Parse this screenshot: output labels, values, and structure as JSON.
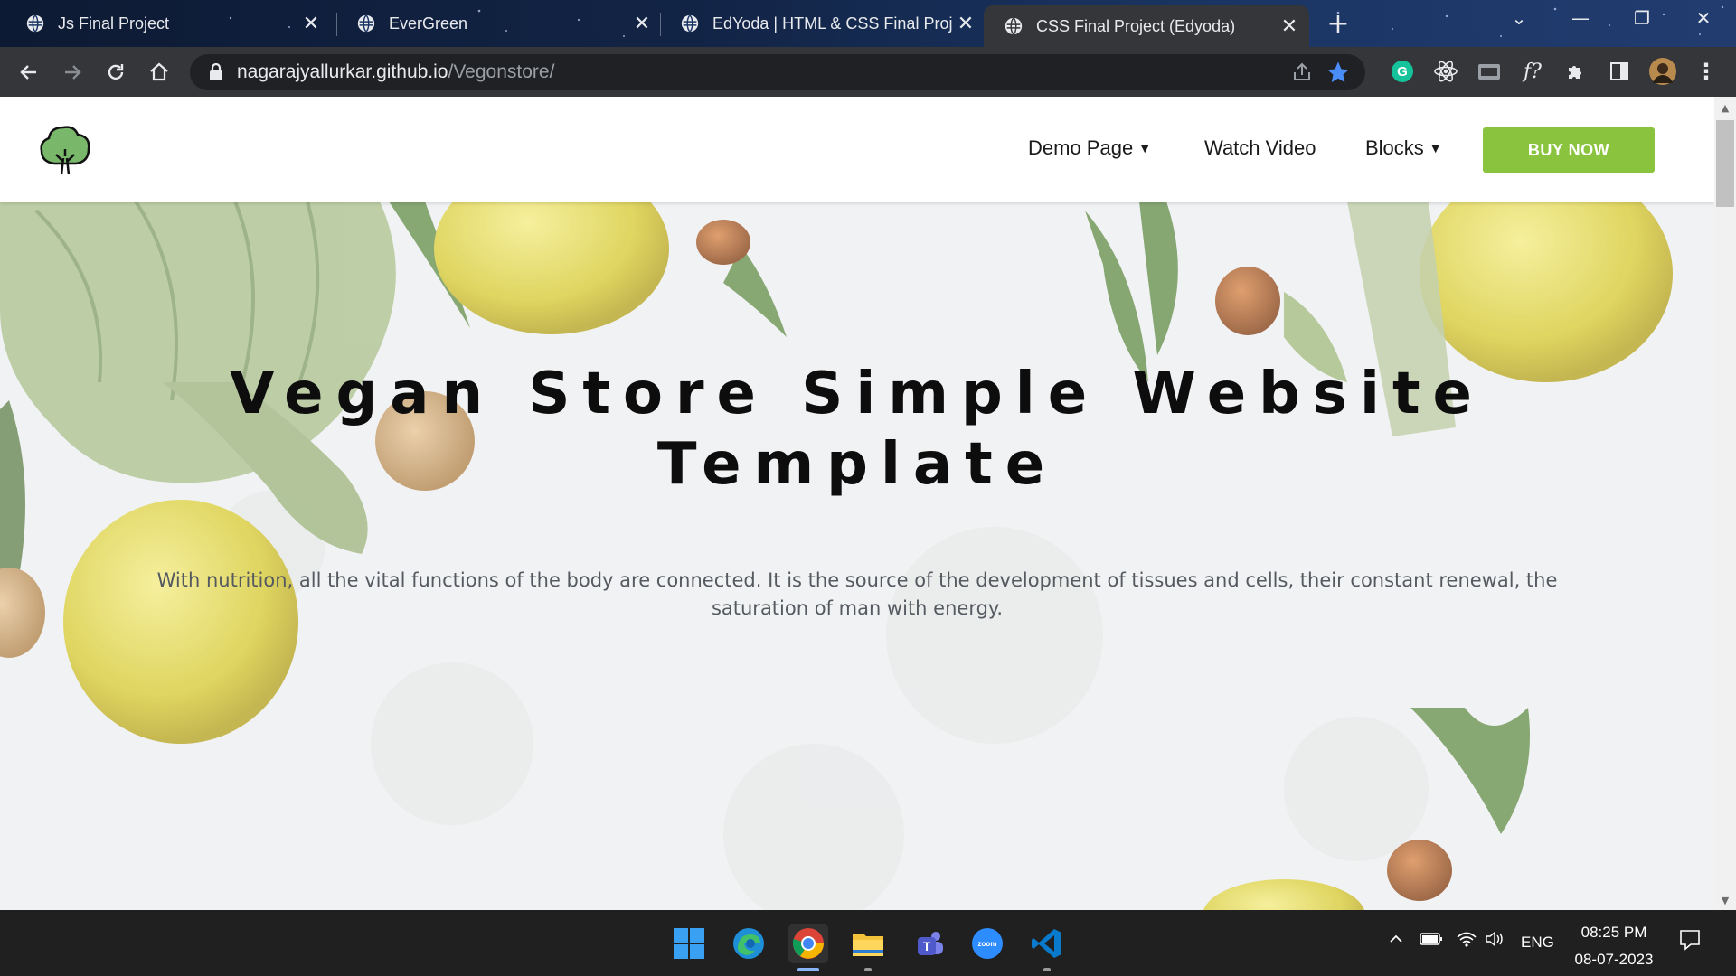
{
  "browser": {
    "tabs": [
      {
        "title": "Js Final Project",
        "active": false
      },
      {
        "title": "EverGreen",
        "active": false
      },
      {
        "title": "EdYoda | HTML & CSS Final Proje",
        "active": false
      },
      {
        "title": "CSS Final Project (Edyoda)",
        "active": true
      }
    ],
    "new_tab_label": "+",
    "address": {
      "host": "nagarajyallurkar.github.io",
      "path": "/Vegonstore/"
    }
  },
  "site": {
    "nav": {
      "items": [
        {
          "label": "Demo Page",
          "dropdown": true
        },
        {
          "label": "Watch Video",
          "dropdown": false
        },
        {
          "label": "Blocks",
          "dropdown": true
        }
      ],
      "cta_label": "BUY NOW"
    },
    "hero": {
      "title_line1": "Vegan Store Simple Website",
      "title_line2": "Template",
      "text": "With nutrition, all the vital functions of the body are connected. It is the source of the development of tissues and cells, their constant renewal, the saturation of man with energy."
    },
    "colors": {
      "accent": "#8ac43f",
      "title": "#0d0d0d",
      "body_text": "#555a60"
    }
  },
  "taskbar": {
    "apps": [
      "windows-start",
      "edge",
      "chrome",
      "file-explorer",
      "teams",
      "zoom",
      "vscode"
    ],
    "tray": {
      "language": "ENG",
      "time": "08:25 PM",
      "date": "08-07-2023"
    }
  }
}
